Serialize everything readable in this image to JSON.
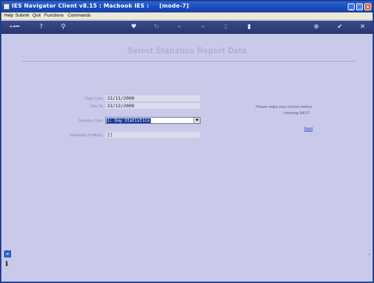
{
  "window": {
    "title": "IES Navigator Client v8.15 : Macbook IES :     [mode-7]",
    "controls": {
      "minimize": "_",
      "maximize": "□",
      "close": "x"
    }
  },
  "menu": {
    "items": [
      "Help",
      "Submit",
      "Quit",
      "Functions",
      "Commands"
    ]
  },
  "toolbar": {
    "icons": [
      "key-icon",
      "help-icon",
      "search-icon",
      "heart-icon",
      "refresh-icon",
      "back-icon",
      "forward-icon",
      "document-icon",
      "page-icon",
      "add-icon",
      "confirm-icon",
      "close-icon"
    ]
  },
  "page": {
    "title": "Select Statistics Report Data"
  },
  "form": {
    "date_from_label": "Date From",
    "date_from_value": "22/11/2008",
    "date_to_label": "Date To",
    "date_to_value": "22/12/2008",
    "stat_type_label": "Statistics Type",
    "stat_type_value": "1: Day Statistics",
    "marketing_label": "Marketing Profile(s)",
    "marketing_value": "[]"
  },
  "help": {
    "line1": "Please make your choices before",
    "line2": "choosing NEXT",
    "next_link": "Next"
  },
  "colors": {
    "background": "#c9c9ea",
    "titlebar": "#2d63d6",
    "toolbar": "#2f3d7c",
    "link": "#1f3fcf",
    "select_highlight": "#1c3a9c"
  }
}
